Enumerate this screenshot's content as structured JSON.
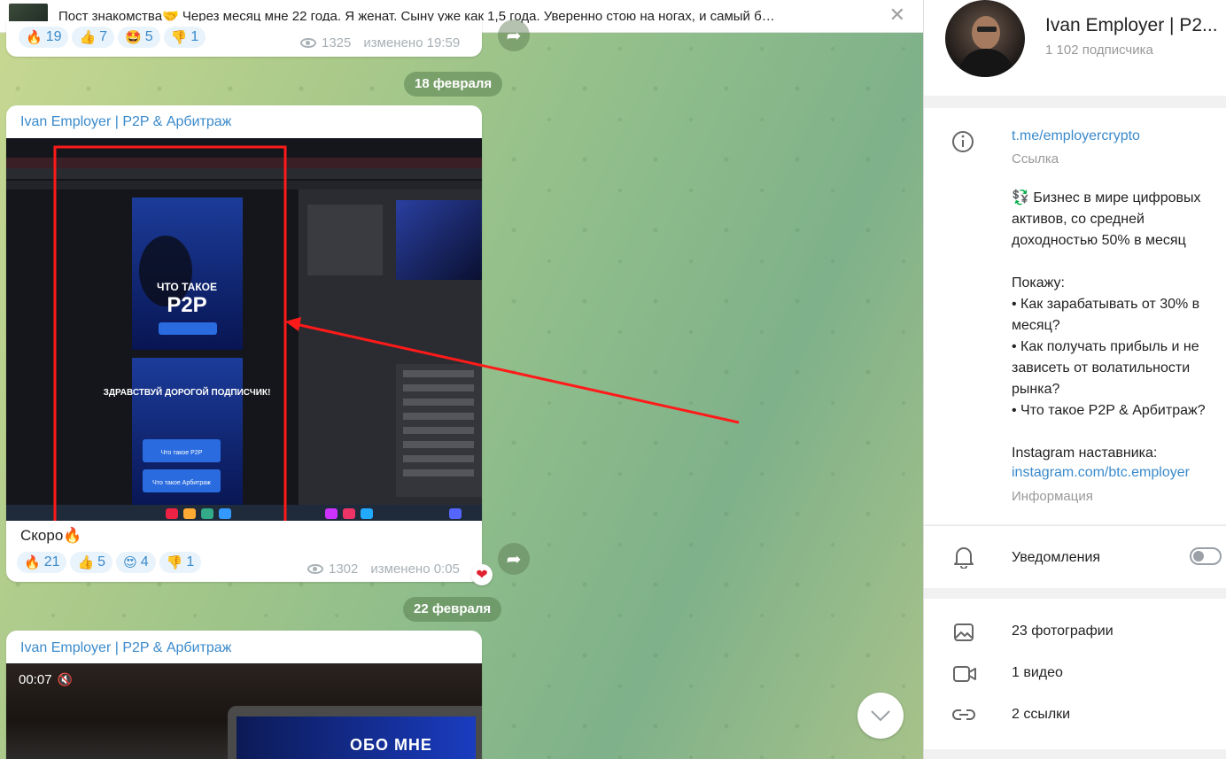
{
  "pinned": {
    "text": "Пост знакомства🤝  Через месяц мне 22 года. Я женат. Сыну уже как 1,5 года. Уверенно стою на ногах, и самый б…"
  },
  "top_message": {
    "reactions": [
      {
        "emoji": "🔥",
        "count": "19"
      },
      {
        "emoji": "👍",
        "count": "7"
      },
      {
        "emoji": "🤩",
        "count": "5"
      },
      {
        "emoji": "👎",
        "count": "1"
      }
    ],
    "views": "1325",
    "edited": "изменено 19:59"
  },
  "date1": "18 февраля",
  "message2": {
    "author": "Ivan Employer | P2P & Арбитраж",
    "text": "Скоро🔥",
    "reactions": [
      {
        "emoji": "🔥",
        "count": "21"
      },
      {
        "emoji": "👍",
        "count": "5"
      },
      {
        "emoji": "😍",
        "count": "4"
      },
      {
        "emoji": "👎",
        "count": "1"
      }
    ],
    "views": "1302",
    "edited": "изменено 0:05",
    "heart": "❤",
    "photo_texts": {
      "t1": "ЧТО ТАКОЕ",
      "t2": "P2P",
      "t3": "ЗДРАВСТВУЙ ДОРОГОЙ ПОДПИСЧИК!",
      "b1": "Что такое P2P",
      "b2": "Что такое Арбитраж"
    }
  },
  "date2": "22 февраля",
  "message3": {
    "author": "Ivan Employer | P2P & Арбитраж",
    "duration": "00:07",
    "video_text": "ОБО МНЕ"
  },
  "side": {
    "channel_name": "Ivan Employer | P2...",
    "subscribers": "1 102 подписчика",
    "link": "t.me/employercrypto",
    "link_label": "Ссылка",
    "description": "💱 Бизнес в мире цифровых активов, со средней доходностью 50% в месяц\n\nПокажу:\n• Как зарабатывать от 30% в месяц?\n• Как получать прибыль и не зависеть от волатильности рынка?\n• Что такое P2P & Арбитраж?\n\nInstagram наставника:",
    "instagram": "instagram.com/btc.employer",
    "info_label": "Информация",
    "notifications": "Уведомления",
    "media": [
      {
        "icon": "image-icon",
        "label": "23 фотографии"
      },
      {
        "icon": "video-icon",
        "label": "1 видео"
      },
      {
        "icon": "link-icon",
        "label": "2 ссылки"
      }
    ]
  }
}
